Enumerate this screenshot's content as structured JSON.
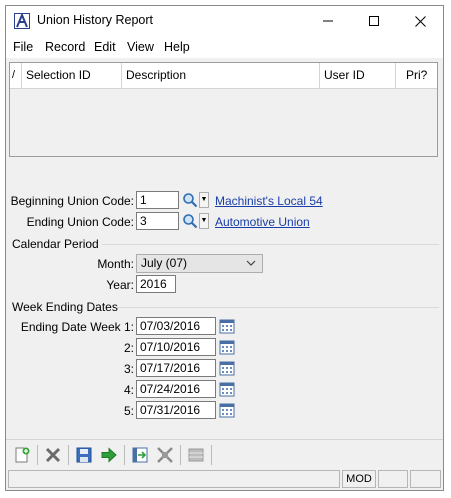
{
  "window": {
    "title": "Union History Report"
  },
  "menu": {
    "file": "File",
    "record": "Record",
    "edit": "Edit",
    "view": "View",
    "help": "Help"
  },
  "grid": {
    "columns": [
      {
        "key": "marker",
        "label": "/"
      },
      {
        "key": "selection_id",
        "label": "Selection ID"
      },
      {
        "key": "description",
        "label": "Description"
      },
      {
        "key": "user_id",
        "label": "User ID"
      },
      {
        "key": "pri",
        "label": "Pri?"
      }
    ]
  },
  "form": {
    "beginning_union": {
      "label": "Beginning Union Code:",
      "value": "1",
      "link": "Machinist's Local 54"
    },
    "ending_union": {
      "label": "Ending Union Code:",
      "value": "3",
      "link": "Automotive Union"
    },
    "calendar_period": {
      "title": "Calendar Period",
      "month_label": "Month:",
      "month_value": "July (07)",
      "year_label": "Year:",
      "year_value": "2016"
    },
    "week_ending": {
      "title": "Week Ending Dates",
      "weeks": [
        {
          "label": "Ending Date Week 1:",
          "value": "07/03/2016"
        },
        {
          "label": "2:",
          "value": "07/10/2016"
        },
        {
          "label": "3:",
          "value": "07/17/2016"
        },
        {
          "label": "4:",
          "value": "07/24/2016"
        },
        {
          "label": "5:",
          "value": "07/31/2016"
        }
      ]
    }
  },
  "status": {
    "mode": "MOD"
  },
  "colors": {
    "link": "#1a3ea8",
    "accent": "#2b3f8f"
  }
}
